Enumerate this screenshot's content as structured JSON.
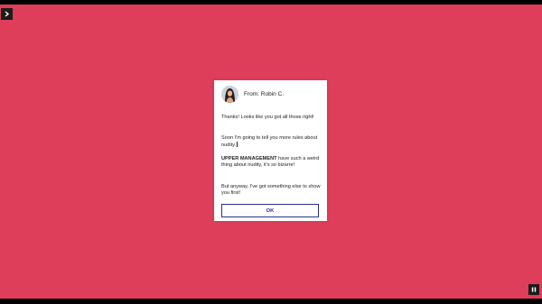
{
  "colors": {
    "stage_background": "#de3e5a",
    "letterbox": "#000000",
    "button_border": "#2b2f8a",
    "dialog_background": "#ffffff"
  },
  "controls": {
    "menu_icon": "chevron-right-icon",
    "pause_icon": "pause-icon"
  },
  "dialog": {
    "from_label": "From: Robin C.",
    "avatar_icon": "avatar-icon",
    "paragraphs": [
      {
        "bold": "",
        "text": "Thanks! Looks like you got all those right!"
      },
      {
        "bold": "",
        "text": "Soon I'm going to tell you more rules about nudity."
      },
      {
        "bold": "UPPER MANAGEMENT",
        "text": " have such a weird thing about nudity, it's so bizarre!"
      },
      {
        "bold": "",
        "text": "But anyway, I've got something else to show you first!"
      }
    ],
    "ok_label": "OK"
  }
}
